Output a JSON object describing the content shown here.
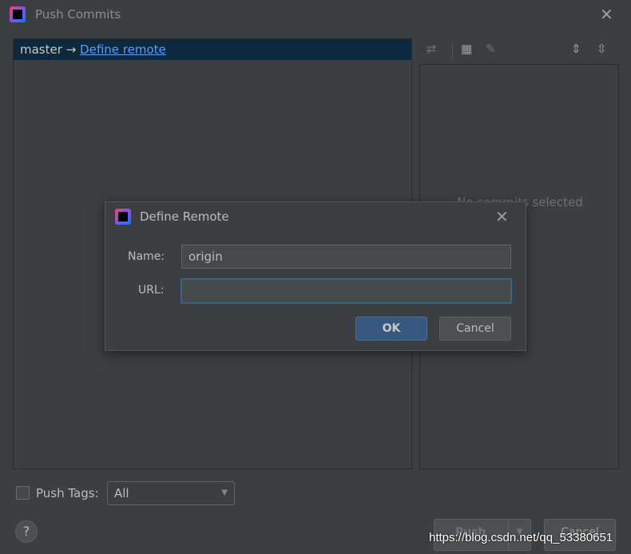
{
  "window": {
    "title": "Push Commits"
  },
  "tree": {
    "branch": "master",
    "arrow": "→",
    "remote_link": "Define remote"
  },
  "details": {
    "empty_text": "No commits selected"
  },
  "footer": {
    "push_tags_label": "Push Tags:",
    "tags_value": "All",
    "help": "?",
    "push_label": "Push",
    "cancel_label": "Cancel"
  },
  "dialog": {
    "title": "Define Remote",
    "name_label": "Name:",
    "name_value": "origin",
    "url_label": "URL:",
    "url_value": "",
    "ok_label": "OK",
    "cancel_label": "Cancel"
  },
  "watermark": "https://blog.csdn.net/qq_53380651",
  "colors": {
    "selection": "#0d293e",
    "link": "#589df6",
    "ok_button": "#365880"
  }
}
